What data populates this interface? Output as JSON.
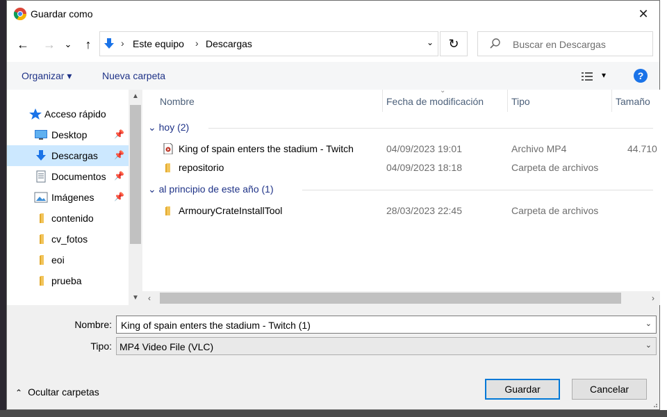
{
  "window": {
    "title": "Guardar como",
    "close_glyph": "✕",
    "app_icon": "chrome-icon"
  },
  "navigation": {
    "back_glyph": "←",
    "forward_glyph": "→",
    "recent_glyph": "⌄",
    "up_glyph": "↑",
    "breadcrumbs": [
      "Este equipo",
      "Descargas"
    ],
    "breadcrumb_separator": "›",
    "dropdown_glyph": "⌄",
    "refresh_glyph": "↻",
    "search_placeholder": "Buscar en Descargas"
  },
  "toolbar": {
    "organize_label": "Organizar ▾",
    "new_folder_label": "Nueva carpeta",
    "view_dropdown_glyph": "▾",
    "help_label": "?"
  },
  "sidebar": {
    "items": [
      {
        "label": "Acceso rápido",
        "icon": "star-icon",
        "pinned": false,
        "selected": false
      },
      {
        "label": "Desktop",
        "icon": "desktop-icon",
        "pinned": true,
        "selected": false
      },
      {
        "label": "Descargas",
        "icon": "download-icon",
        "pinned": true,
        "selected": true
      },
      {
        "label": "Documentos",
        "icon": "documents-icon",
        "pinned": true,
        "selected": false
      },
      {
        "label": "Imágenes",
        "icon": "images-icon",
        "pinned": true,
        "selected": false
      },
      {
        "label": "contenido",
        "icon": "folder-icon",
        "pinned": false,
        "selected": false
      },
      {
        "label": "cv_fotos",
        "icon": "folder-icon",
        "pinned": false,
        "selected": false
      },
      {
        "label": "eoi",
        "icon": "folder-icon",
        "pinned": false,
        "selected": false
      },
      {
        "label": "prueba",
        "icon": "folder-icon",
        "pinned": false,
        "selected": false
      }
    ],
    "pin_glyph": "📌"
  },
  "file_list": {
    "columns": [
      "Nombre",
      "Fecha de modificación",
      "Tipo",
      "Tamaño"
    ],
    "groups": [
      {
        "label": "hoy (2)",
        "rows": [
          {
            "name": "King of spain enters the stadium - Twitch",
            "date": "04/09/2023 19:01",
            "type": "Archivo MP4",
            "size": "44.710",
            "icon": "video-file-icon"
          },
          {
            "name": "repositorio",
            "date": "04/09/2023 18:18",
            "type": "Carpeta de archivos",
            "size": "",
            "icon": "folder-icon"
          }
        ]
      },
      {
        "label": "al principio de este año (1)",
        "rows": [
          {
            "name": "ArmouryCrateInstallTool",
            "date": "28/03/2023 22:45",
            "type": "Carpeta de archivos",
            "size": "",
            "icon": "folder-icon"
          }
        ]
      }
    ]
  },
  "form": {
    "filename_label": "Nombre:",
    "filename_value": "King of spain enters the stadium - Twitch (1)",
    "type_label": "Tipo:",
    "type_value": "MP4 Video File (VLC)"
  },
  "footer": {
    "hide_folders_label": "Ocultar carpetas",
    "save_label": "Guardar",
    "cancel_label": "Cancelar"
  },
  "colors": {
    "accent": "#0078d7",
    "link": "#1e3287",
    "selection": "#cce8ff",
    "folder": "#f2c55c"
  }
}
